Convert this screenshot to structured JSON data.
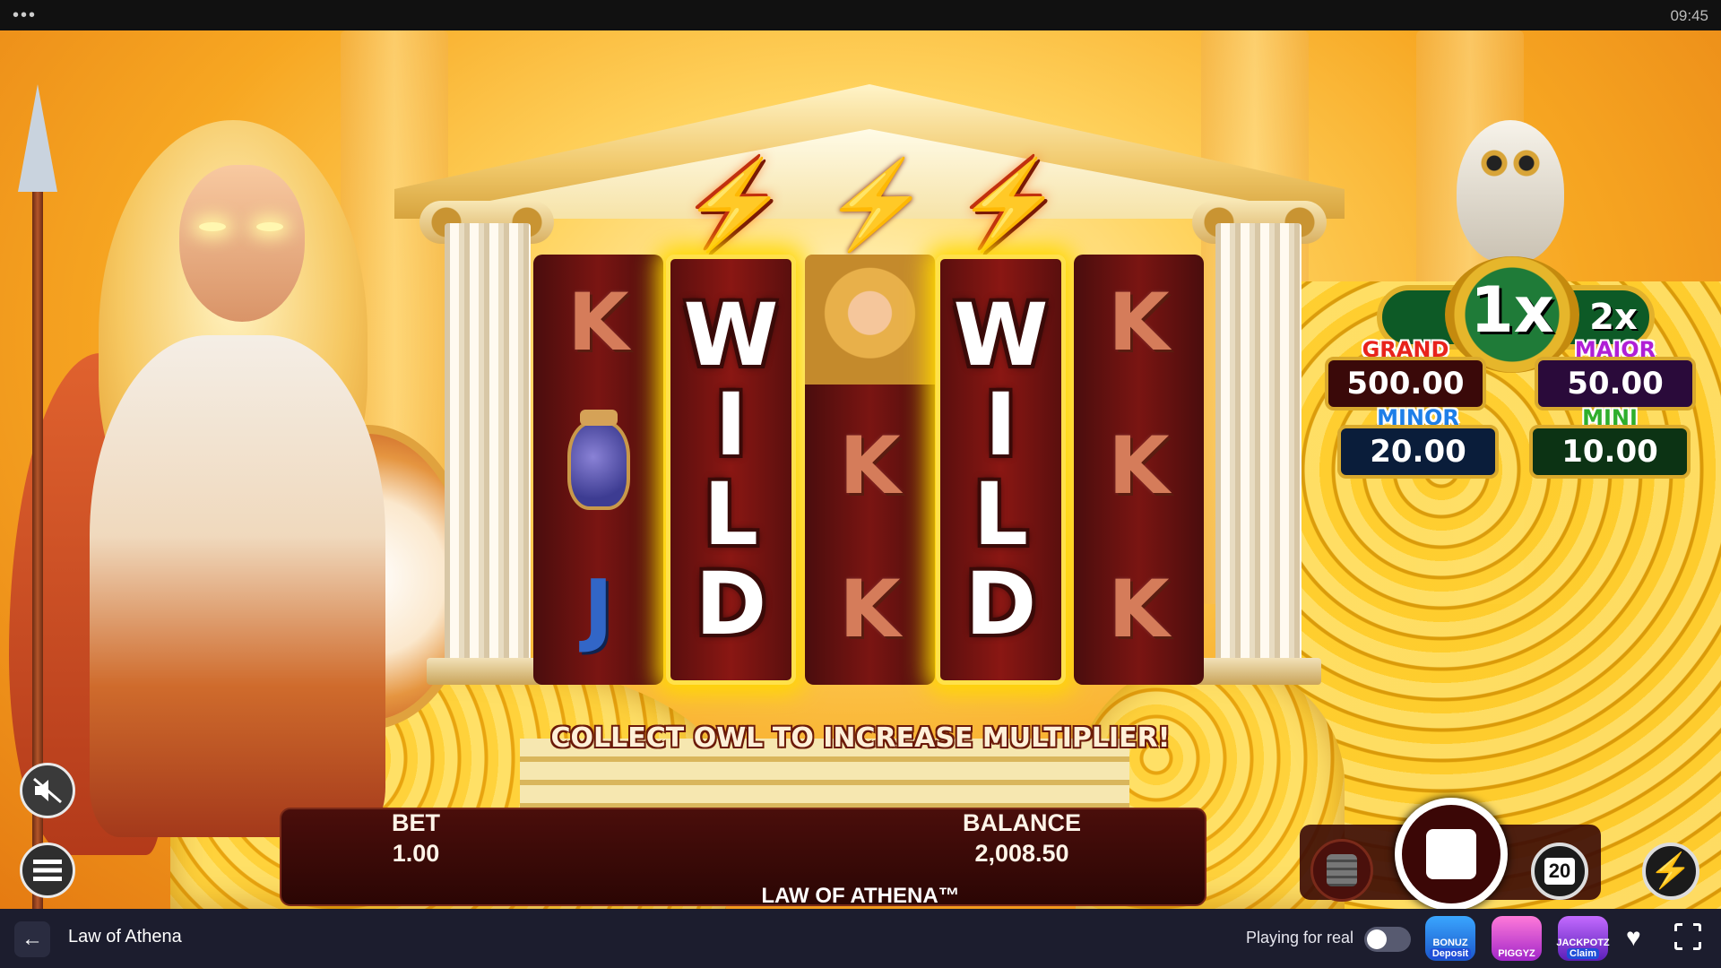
{
  "status_bar": {
    "menu_dots": "•••",
    "time": "09:45"
  },
  "game": {
    "title": "LAW OF ATHENA™",
    "message": "COLLECT OWL TO INCREASE MULTIPLIER!",
    "reels": [
      {
        "symbols": [
          "K",
          "vase",
          "J"
        ],
        "highlight": false
      },
      {
        "wild": [
          "W",
          "I",
          "L",
          "D"
        ],
        "highlight": true
      },
      {
        "symbols": [
          "athena",
          "K",
          "K"
        ],
        "highlight": false
      },
      {
        "wild": [
          "W",
          "I",
          "L",
          "D"
        ],
        "highlight": true
      },
      {
        "symbols": [
          "K",
          "K",
          "K"
        ],
        "highlight": false
      }
    ],
    "multiplier": {
      "current": "1x",
      "next": "2x"
    },
    "jackpots": {
      "grand": {
        "label": "GRAND",
        "value": "500.00",
        "color": "#e8231c"
      },
      "major": {
        "label": "MAJOR",
        "value": "50.00",
        "color": "#b01fd6"
      },
      "minor": {
        "label": "MINOR",
        "value": "20.00",
        "color": "#1e7fe8"
      },
      "mini": {
        "label": "MINI",
        "value": "10.00",
        "color": "#2fae2c"
      }
    },
    "bet": {
      "label": "BET",
      "value": "1.00"
    },
    "balance": {
      "label": "BALANCE",
      "value": "2,008.50"
    },
    "autoplay_count": "20",
    "icons": {
      "sound": "muted-speaker-icon",
      "menu": "hamburger-icon",
      "coins": "coin-stack-icon",
      "spin": "stop-square-icon",
      "turbo": "lightning-icon"
    }
  },
  "host_bar": {
    "back": "←",
    "title": "Law of Athena",
    "real_play_label": "Playing for real",
    "real_play_on": false,
    "promos": [
      {
        "name": "BONUZ",
        "action": "Deposit"
      },
      {
        "name": "PIGGYZ",
        "action": ""
      },
      {
        "name": "JACKPOTZ",
        "action": "Claim"
      }
    ]
  }
}
